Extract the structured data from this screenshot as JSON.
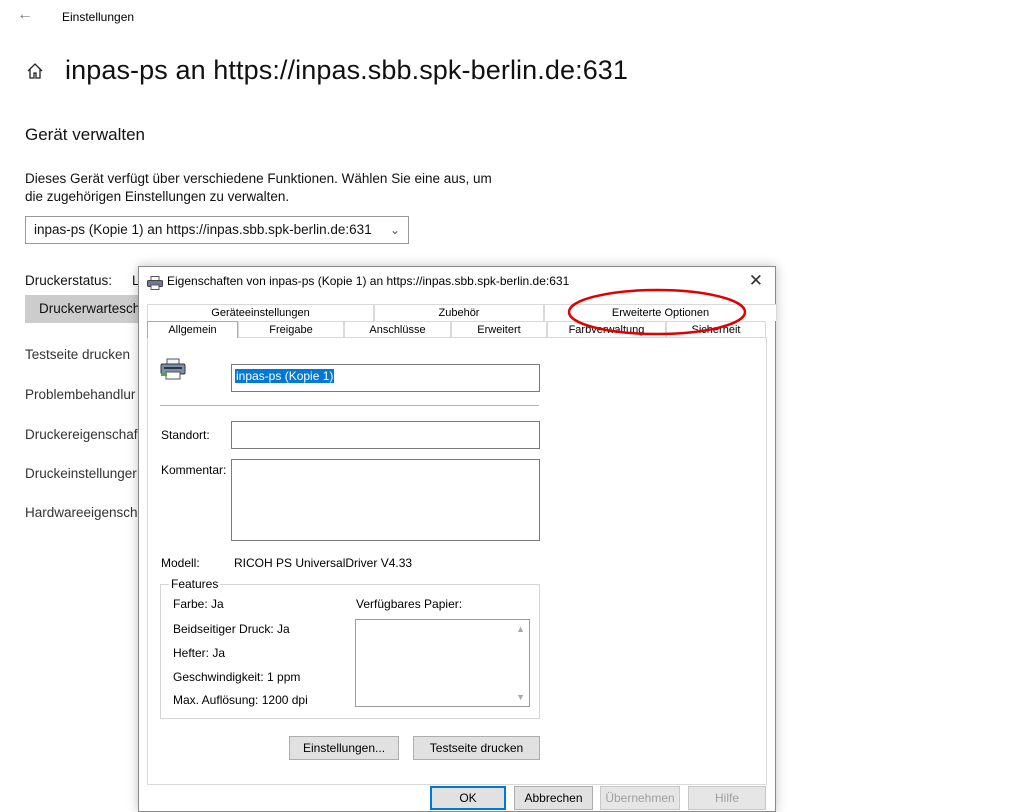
{
  "header": {
    "back_icon": "back-arrow-icon",
    "app_title": "Einstellungen",
    "home_icon": "home-icon",
    "page_title": "inpas-ps an https://inpas.sbb.spk-berlin.de:631"
  },
  "manage": {
    "section_title": "Gerät verwalten",
    "description": "Dieses Gerät verfügt über verschiedene Funktionen. Wählen Sie eine aus, um die zugehörigen Einstellungen zu verwalten.",
    "device_selected": "inpas-ps (Kopie 1) an https://inpas.sbb.spk-berlin.de:631",
    "status_label": "Druckerstatus:",
    "status_value": "L",
    "queue_button": "Druckerwarteschl",
    "links": [
      "Testseite drucken",
      "Problembehandlur",
      "Druckereigenschaf",
      "Druckeinstellunger",
      "Hardwareeigensch"
    ]
  },
  "dialog": {
    "title": "Eigenschaften von inpas-ps (Kopie 1) an https://inpas.sbb.spk-berlin.de:631",
    "close_icon": "close-icon",
    "tabs_row1": [
      "Geräteeinstellungen",
      "Zubehör",
      "Erweiterte Optionen"
    ],
    "tabs_row2": [
      "Allgemein",
      "Freigabe",
      "Anschlüsse",
      "Erweitert",
      "Farbverwaltung",
      "Sicherheit"
    ],
    "active_tab": "Allgemein",
    "printer_name": "inpas-ps (Kopie 1)",
    "location_label": "Standort:",
    "location_value": "",
    "comment_label": "Kommentar:",
    "comment_value": "",
    "model_label": "Modell:",
    "model_value": "RICOH PS UniversalDriver V4.33",
    "features": {
      "legend": "Features",
      "color": "Farbe: Ja",
      "duplex": "Beidseitiger Druck: Ja",
      "stapler": "Hefter: Ja",
      "speed": "Geschwindigkeit: 1 ppm",
      "resolution": "Max. Auflösung: 1200 dpi",
      "paper_label": "Verfügbares Papier:",
      "paper_items": []
    },
    "buttons": {
      "settings": "Einstellungen...",
      "test_page": "Testseite drucken",
      "ok": "OK",
      "cancel": "Abbrechen",
      "apply": "Übernehmen",
      "help": "Hilfe"
    }
  },
  "colors": {
    "selection": "#0078d7",
    "annotation": "#e00000"
  }
}
